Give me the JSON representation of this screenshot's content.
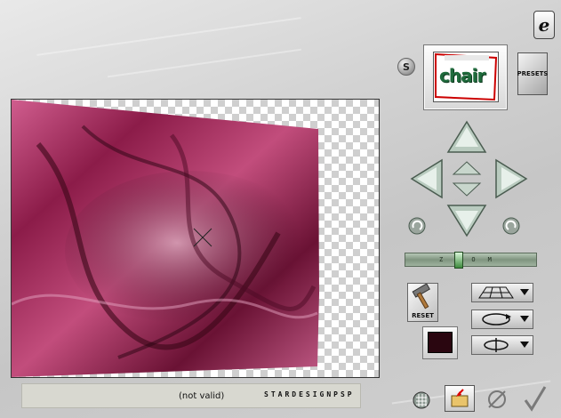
{
  "toolbar": {
    "s_label": "S",
    "presets_label": "PRESETS",
    "reset_label": "RESET",
    "logo_letter": "e"
  },
  "thumbnail": {
    "text": "chair"
  },
  "zoom": {
    "label": "ZOOM",
    "value": 0.38
  },
  "status": {
    "text": "(not valid)",
    "brand": "STARDESIGNPSP"
  },
  "icons": {
    "up": "arrow-up-icon",
    "down": "arrow-down-icon",
    "left": "arrow-left-icon",
    "right": "arrow-right-icon",
    "rot_left": "rotate-left-icon",
    "rot_right": "rotate-right-icon",
    "grid": "grid-icon",
    "open": "folder-open-icon",
    "cancel": "cancel-icon",
    "ok": "checkmark-icon",
    "hammer": "hammer-icon",
    "perspective": "perspective-grid-icon",
    "rot_h": "horizontal-rotate-icon",
    "flip": "flip-icon"
  },
  "colors": {
    "accent_green": "#1f6b3c",
    "image_magenta": "#b03a6a"
  }
}
